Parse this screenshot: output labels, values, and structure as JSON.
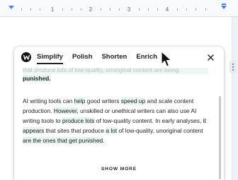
{
  "ruler": {
    "numbers": [
      "1",
      "2",
      "3",
      "4"
    ]
  },
  "panel": {
    "tabs": [
      {
        "label": "Simplify",
        "active": true
      },
      {
        "label": "Polish",
        "active": false
      },
      {
        "label": "Shorten",
        "active": false
      },
      {
        "label": "Enrich",
        "active": false
      }
    ],
    "previous_fragment": {
      "line1": "that produce lots of low-quality, unoriginal content are being",
      "line2": "punished."
    },
    "paragraph": {
      "p1": "AI writing tools can ",
      "h1": "help",
      "p2": " good writers ",
      "h2": "speed up",
      "p3": " and scale content production. ",
      "h3": "However,",
      "p4": " unskilled or unethical writers can also use AI writing tools to ",
      "h4": "produce lots",
      "p5": " of low-quality content. In early analyses, ",
      "h5": "it appears",
      "p6": " that sites that produce ",
      "h6": "a lot",
      "p7": " of low-quality, unoriginal content ",
      "h7": "are the ones that get punished",
      "p8": "."
    },
    "show_more_label": "SHOW MORE"
  },
  "icons": {
    "logo": "wordtune-logo-icon",
    "close": "close-icon",
    "cursor": "mouse-pointer-icon",
    "side_chip": "grid-dots-icon"
  },
  "colors": {
    "highlight": "#e6f3ee",
    "ruler_marker": "#4a7ee6",
    "side_chip_dots": "#4a5bd8"
  }
}
